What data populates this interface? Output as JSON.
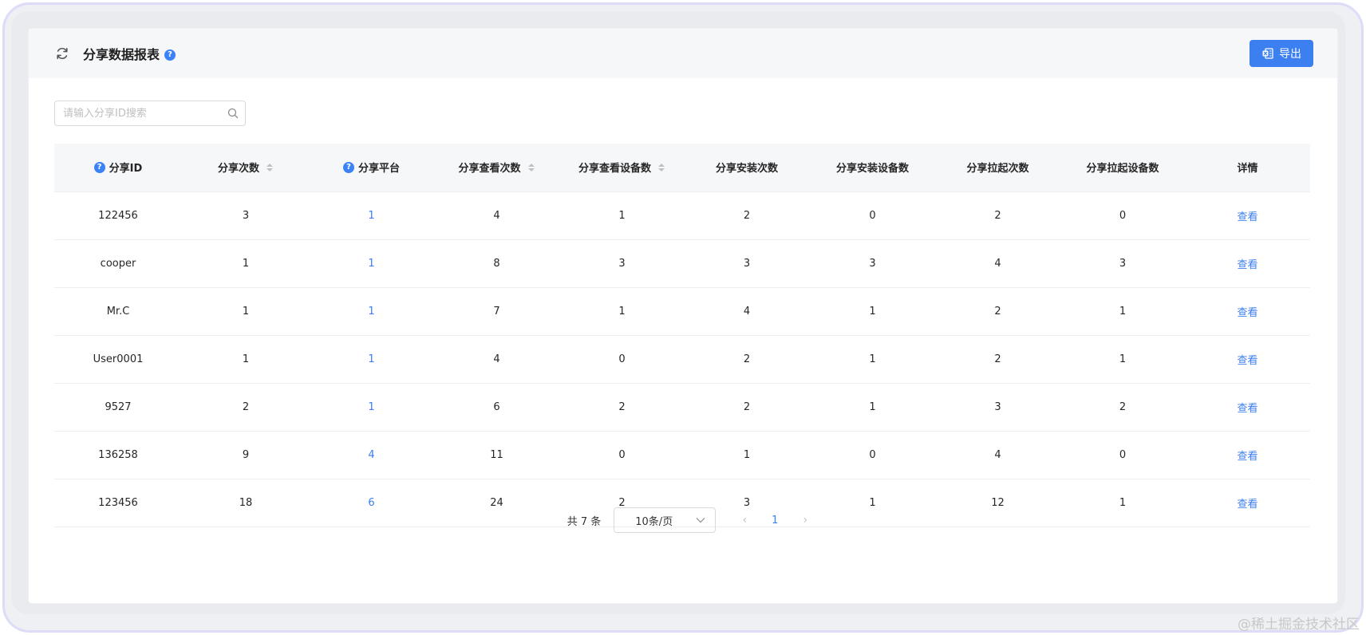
{
  "header": {
    "title": "分享数据报表",
    "help": "?",
    "export_label": "导出"
  },
  "search": {
    "placeholder": "请输入分享ID搜索",
    "value": ""
  },
  "table": {
    "columns": [
      {
        "label": "分享ID",
        "help": true,
        "sortable": false
      },
      {
        "label": "分享次数",
        "help": false,
        "sortable": true
      },
      {
        "label": "分享平台",
        "help": true,
        "sortable": false
      },
      {
        "label": "分享查看次数",
        "help": false,
        "sortable": true
      },
      {
        "label": "分享查看设备数",
        "help": false,
        "sortable": true
      },
      {
        "label": "分享安装次数",
        "help": false,
        "sortable": false
      },
      {
        "label": "分享安装设备数",
        "help": false,
        "sortable": false
      },
      {
        "label": "分享拉起次数",
        "help": false,
        "sortable": false
      },
      {
        "label": "分享拉起设备数",
        "help": false,
        "sortable": false
      },
      {
        "label": "详情",
        "help": false,
        "sortable": false
      }
    ],
    "rows": [
      {
        "id": "122456",
        "share_count": "3",
        "platform": "1",
        "view_count": "4",
        "view_devices": "1",
        "install_count": "2",
        "install_devices": "0",
        "launch_count": "2",
        "launch_devices": "0",
        "detail": "查看"
      },
      {
        "id": "cooper",
        "share_count": "1",
        "platform": "1",
        "view_count": "8",
        "view_devices": "3",
        "install_count": "3",
        "install_devices": "3",
        "launch_count": "4",
        "launch_devices": "3",
        "detail": "查看"
      },
      {
        "id": "Mr.C",
        "share_count": "1",
        "platform": "1",
        "view_count": "7",
        "view_devices": "1",
        "install_count": "4",
        "install_devices": "1",
        "launch_count": "2",
        "launch_devices": "1",
        "detail": "查看"
      },
      {
        "id": "User0001",
        "share_count": "1",
        "platform": "1",
        "view_count": "4",
        "view_devices": "0",
        "install_count": "2",
        "install_devices": "1",
        "launch_count": "2",
        "launch_devices": "1",
        "detail": "查看"
      },
      {
        "id": "9527",
        "share_count": "2",
        "platform": "1",
        "view_count": "6",
        "view_devices": "2",
        "install_count": "2",
        "install_devices": "1",
        "launch_count": "3",
        "launch_devices": "2",
        "detail": "查看"
      },
      {
        "id": "136258",
        "share_count": "9",
        "platform": "4",
        "view_count": "11",
        "view_devices": "0",
        "install_count": "1",
        "install_devices": "0",
        "launch_count": "4",
        "launch_devices": "0",
        "detail": "查看"
      },
      {
        "id": "123456",
        "share_count": "18",
        "platform": "6",
        "view_count": "24",
        "view_devices": "2",
        "install_count": "3",
        "install_devices": "1",
        "launch_count": "12",
        "launch_devices": "1",
        "detail": "查看"
      }
    ]
  },
  "pagination": {
    "total_text": "共 7 条",
    "page_size": "10条/页",
    "current_page": "1",
    "prev": "‹",
    "next": "›"
  },
  "watermark": "@稀土掘金技术社区",
  "colors": {
    "primary": "#3b7ff0",
    "header_bg": "#f6f7f9",
    "frame_border": "#dcdcf8"
  }
}
